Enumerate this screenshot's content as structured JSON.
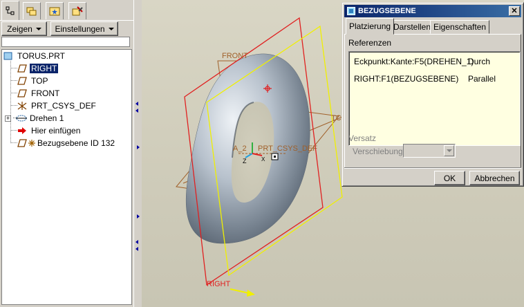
{
  "sidebar": {
    "tab_icons": [
      "model-tree-icon",
      "layers-icon",
      "star-icon",
      "tools-icon"
    ],
    "zeigen_label": "Zeigen",
    "einstellungen_label": "Einstellungen",
    "tree_items": [
      {
        "label": "TORUS.PRT",
        "icon": "part-icon"
      },
      {
        "label": "RIGHT",
        "icon": "datum-plane-icon",
        "selected": true
      },
      {
        "label": "TOP",
        "icon": "datum-plane-icon"
      },
      {
        "label": "FRONT",
        "icon": "datum-plane-icon"
      },
      {
        "label": "PRT_CSYS_DEF",
        "icon": "csys-icon"
      },
      {
        "label": "Drehen 1",
        "icon": "revolve-icon"
      },
      {
        "label": "Hier einfügen",
        "icon": "insert-arrow-icon"
      },
      {
        "label": "Bezugsebene ID 132",
        "icon": "datum-plane-new-icon"
      }
    ]
  },
  "viewport": {
    "labels": {
      "front": "FRONT",
      "right": "RIGHT",
      "top": "TC",
      "axis": "A_2",
      "csys": "PRT_CSYS_DEF",
      "z": "Z",
      "x": "X"
    },
    "colors": {
      "red": "#e02020",
      "yellow": "#f0f000",
      "brown": "#a0602a",
      "green": "#30b040"
    }
  },
  "dialog": {
    "title": "BEZUGSEBENE",
    "close": "✕",
    "tabs": [
      "Platzierung",
      "Darstellen",
      "Eigenschaften"
    ],
    "active_tab": "Platzierung",
    "referenzen_label": "Referenzen",
    "references": [
      {
        "ref": "Eckpunkt:Kante:F5(DREHEN_1)",
        "constraint": "Durch"
      },
      {
        "ref": "RIGHT:F1(BEZUGSEBENE)",
        "constraint": "Parallel"
      }
    ],
    "versatz_label": "Versatz",
    "verschiebung_label": "Verschiebung",
    "ok_label": "OK",
    "cancel_label": "Abbrechen"
  }
}
